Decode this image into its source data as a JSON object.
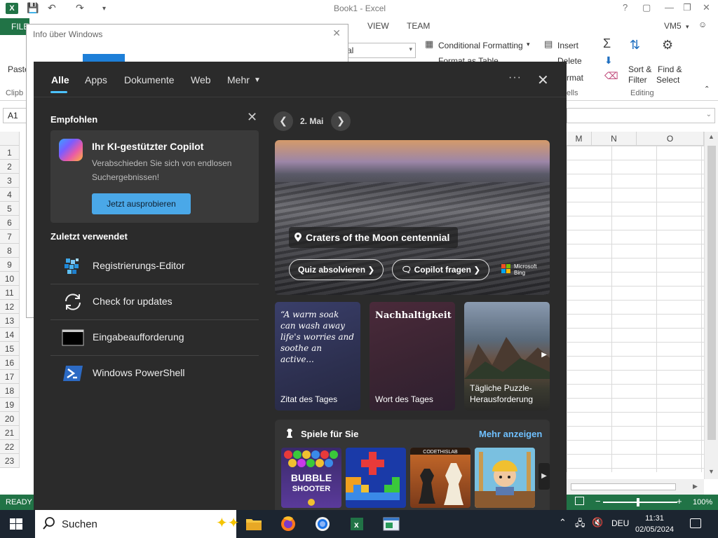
{
  "excel": {
    "title": "Book1 - Excel",
    "file_tab": "FILE",
    "tabs": [
      "VIEW",
      "TEAM"
    ],
    "user": "VM5",
    "ribbon": {
      "conditional_formatting": "Conditional Formatting",
      "format_as_table": "Format as Table",
      "insert": "Insert",
      "delete": "Delete",
      "format": "rmat",
      "sort_filter_1": "Sort &",
      "sort_filter_2": "Filter",
      "find_select_1": "Find &",
      "find_select_2": "Select",
      "editing": "Editing",
      "cells": "ells",
      "clipboard": "Clipb",
      "paste": "Paste",
      "font_box": "al"
    },
    "name_box": "A1",
    "columns": [
      "M",
      "N",
      "O"
    ],
    "rows": [
      "1",
      "2",
      "3",
      "4",
      "5",
      "6",
      "7",
      "8",
      "9",
      "10",
      "11",
      "12",
      "13",
      "14",
      "15",
      "16",
      "17",
      "18",
      "19",
      "20",
      "21",
      "22",
      "23"
    ],
    "status": "READY",
    "zoom": "100%"
  },
  "about_dialog": {
    "title": "Info über Windows"
  },
  "search_flyout": {
    "tabs": [
      "Alle",
      "Apps",
      "Dokumente",
      "Web",
      "Mehr"
    ],
    "active_tab": "Alle",
    "recommended": {
      "heading": "Empfohlen",
      "copilot_title": "Ihr KI-gestützter Copilot",
      "copilot_desc": "Verabschieden Sie sich von endlosen Suchergebnissen!",
      "copilot_button": "Jetzt ausprobieren"
    },
    "recent": {
      "heading": "Zuletzt verwendet",
      "items": [
        {
          "label": "Registrierungs-Editor",
          "icon": "registry-editor-icon"
        },
        {
          "label": "Check for updates",
          "icon": "sync-icon"
        },
        {
          "label": "Eingabeaufforderung",
          "icon": "command-prompt-icon"
        },
        {
          "label": "Windows PowerShell",
          "icon": "powershell-icon"
        }
      ]
    },
    "date": "2. Mai",
    "hero": {
      "title": "Craters of the Moon centennial",
      "quiz_button": "Quiz absolvieren",
      "copilot_button": "Copilot fragen",
      "brand_line1": "Microsoft",
      "brand_line2": "Bing"
    },
    "tiles": {
      "quote_text": "“A warm soak can wash away life's worries and soothe an active...",
      "quote_label": "Zitat des Tages",
      "word_text": "Nachhaltigkeit",
      "word_label": "Wort des Tages",
      "puzzle_label_1": "Tägliche Puzzle-",
      "puzzle_label_2": "Herausforderung"
    },
    "games": {
      "heading": "Spiele für Sie",
      "more_link": "Mehr anzeigen",
      "game1_text_1": "BUBBLE",
      "game1_text_2": "SHOOTER",
      "game3_text": "CODETHISLAB"
    }
  },
  "taskbar": {
    "search_placeholder": "Suchen",
    "language": "DEU",
    "time": "11:31",
    "date": "02/05/2024"
  },
  "colors": {
    "excel_green": "#217346",
    "flyout_bg": "#2b2b2b",
    "accent": "#4cc2ff",
    "taskbar": "#1c2530"
  }
}
